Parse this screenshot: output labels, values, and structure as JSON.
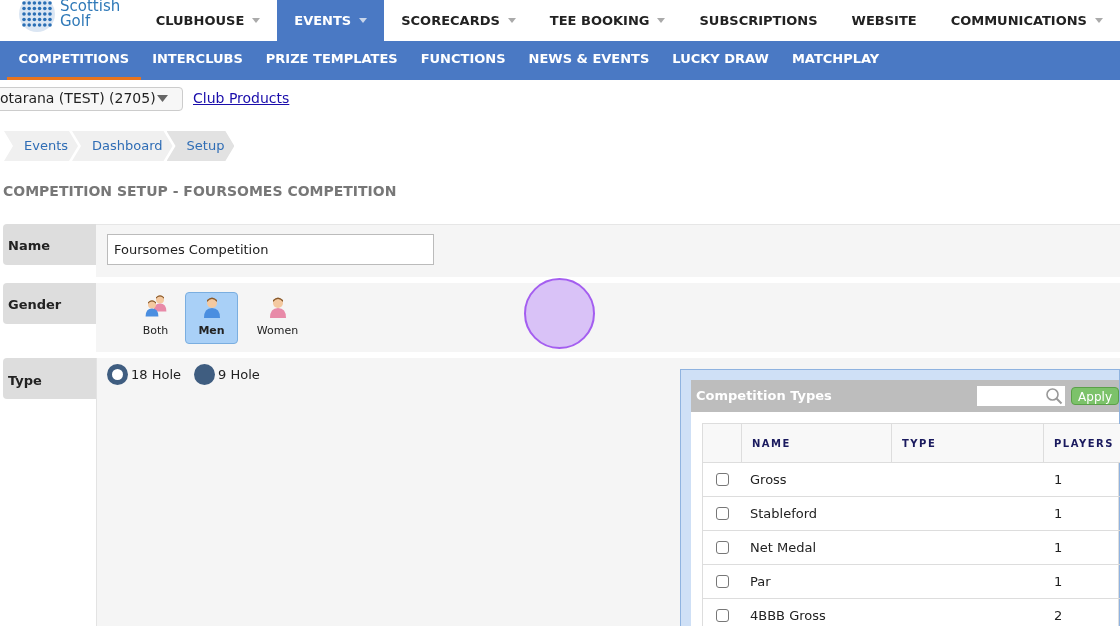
{
  "logo": {
    "line1": "Scottish",
    "line2": "Golf"
  },
  "top_nav": [
    {
      "label": "CLUBHOUSE",
      "dropdown": true,
      "selected": false
    },
    {
      "label": "EVENTS",
      "dropdown": true,
      "selected": true
    },
    {
      "label": "SCORECARDS",
      "dropdown": true,
      "selected": false
    },
    {
      "label": "TEE BOOKING",
      "dropdown": true,
      "selected": false
    },
    {
      "label": "SUBSCRIPTIONS",
      "dropdown": false,
      "selected": false
    },
    {
      "label": "WEBSITE",
      "dropdown": false,
      "selected": false
    },
    {
      "label": "COMMUNICATIONS",
      "dropdown": true,
      "selected": false
    }
  ],
  "sub_nav": [
    {
      "label": "COMPETITIONS",
      "selected": true
    },
    {
      "label": "INTERCLUBS",
      "selected": false
    },
    {
      "label": "PRIZE TEMPLATES",
      "selected": false
    },
    {
      "label": "FUNCTIONS",
      "selected": false
    },
    {
      "label": "NEWS & EVENTS",
      "selected": false
    },
    {
      "label": "LUCKY DRAW",
      "selected": false
    },
    {
      "label": "MATCHPLAY",
      "selected": false
    }
  ],
  "club_select": {
    "value": "otarana (TEST) (2705)"
  },
  "club_products_link": "Club Products",
  "breadcrumb": [
    {
      "label": "Events",
      "selected": false
    },
    {
      "label": "Dashboard",
      "selected": false
    },
    {
      "label": "Setup",
      "selected": true
    }
  ],
  "heading": "COMPETITION SETUP - FOURSOMES COMPETITION",
  "name_row": {
    "label": "Name",
    "value": "Foursomes Competition"
  },
  "gender_row": {
    "label": "Gender",
    "options": [
      {
        "label": "Both",
        "kind": "both",
        "selected": false
      },
      {
        "label": "Men",
        "kind": "men",
        "selected": true
      },
      {
        "label": "Women",
        "kind": "women",
        "selected": false
      }
    ]
  },
  "type_row": {
    "label": "Type",
    "options": [
      {
        "label": "18 Hole",
        "selected": true
      },
      {
        "label": "9 Hole",
        "selected": false
      }
    ]
  },
  "competition_types": {
    "title": "Competition Types",
    "apply_button": "Apply",
    "columns": [
      "NAME",
      "TYPE",
      "PLAYERS"
    ],
    "rows": [
      {
        "checked": false,
        "name": "Gross",
        "players": "1"
      },
      {
        "checked": false,
        "name": "Stableford",
        "players": "1"
      },
      {
        "checked": false,
        "name": "Net Medal",
        "players": "1"
      },
      {
        "checked": false,
        "name": "Par",
        "players": "1"
      },
      {
        "checked": false,
        "name": "4BBB Gross",
        "players": "2"
      }
    ]
  },
  "click_indicator": true
}
